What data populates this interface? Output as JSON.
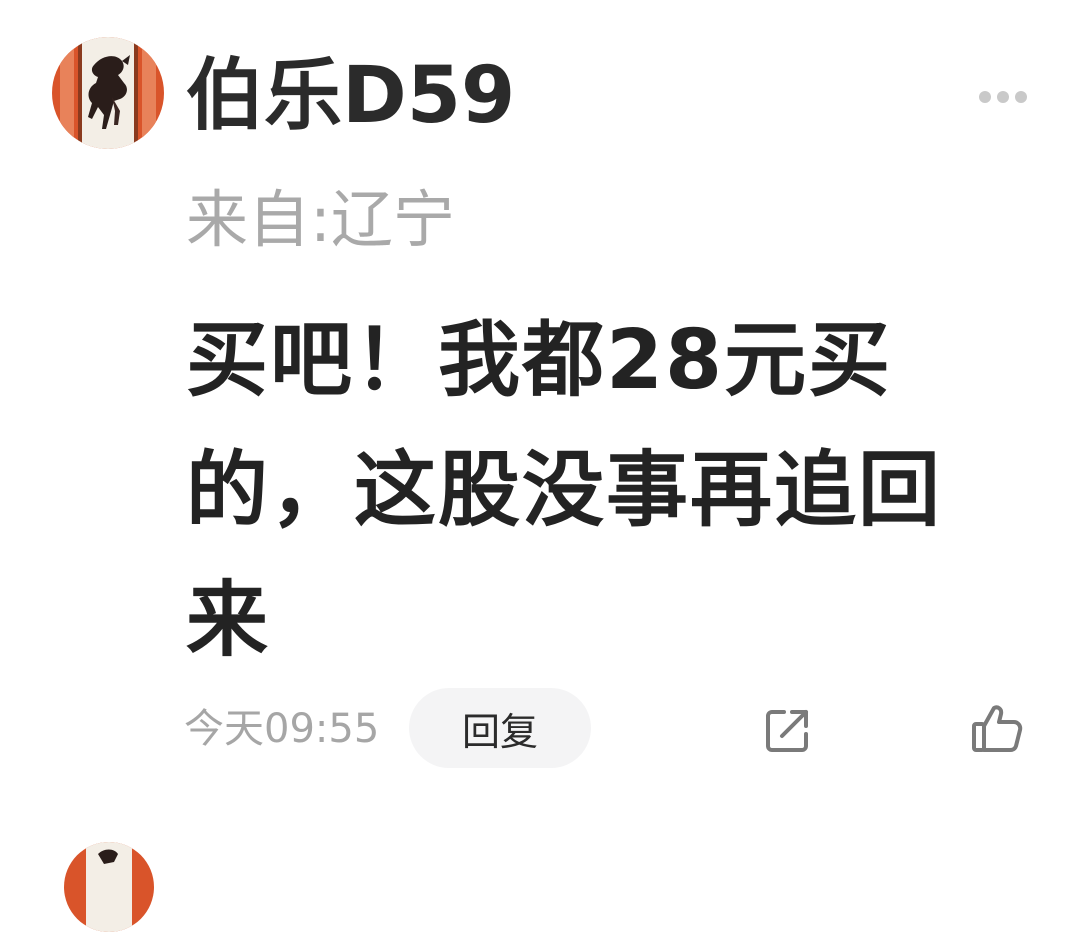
{
  "comment": {
    "username": "伯乐D59",
    "location": "来自:辽宁",
    "content": "买吧！我都28元买的，这股没事再追回来",
    "timestamp": "今天09:55",
    "reply_label": "回复",
    "icons": {
      "more": "more-dots-icon",
      "share": "share-icon",
      "like": "thumbs-up-icon",
      "avatar": "horse-painting-avatar"
    }
  },
  "colors": {
    "username": "#2b2b2b",
    "secondary_text": "#a9a9a9",
    "reply_bg": "#f4f4f5",
    "icon": "#7a7a7a",
    "avatar_frame": "#d9542a"
  }
}
